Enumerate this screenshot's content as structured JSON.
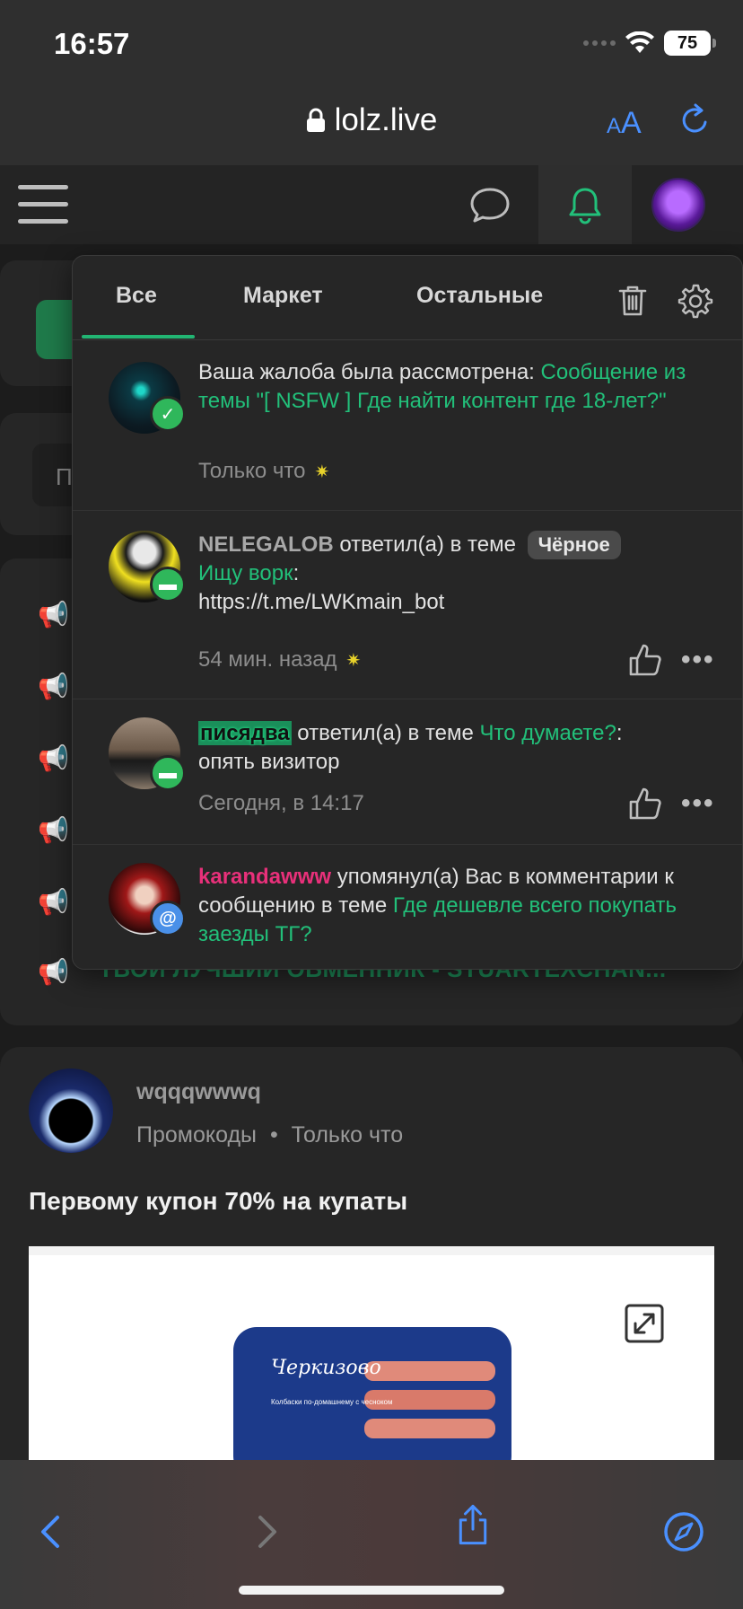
{
  "status": {
    "time": "16:57",
    "battery": "75"
  },
  "browser": {
    "url": "lolz.live",
    "text_size_small": "A",
    "text_size_large": "A"
  },
  "tabs": [
    "Все",
    "Маркет",
    "Остальные"
  ],
  "notifications": {
    "n1": {
      "prefix": "Ваша жалоба была рассмотрена: ",
      "link": "Сообщение из темы \"[ NSFW ] Где найти контент где 18-лет?\"",
      "time": "Только что"
    },
    "n2": {
      "user": "NELEGALOB",
      "action": " ответил(а) в теме ",
      "tag": "Чёрное",
      "topic": "Ищу ворк",
      "colon": ":",
      "message": "https://t.me/LWKmain_bot",
      "time": "54 мин. назад"
    },
    "n3": {
      "user": "писядва",
      "action": " ответил(а) в теме ",
      "topic": "Что думаете?",
      "colon": ":",
      "message": "опять визитор",
      "time": "Сегодня, в 14:17"
    },
    "n4": {
      "user": "karandawww",
      "action": " упомянул(а) Вас в комментарии к сообщению в теме ",
      "topic": "Где дешевле всего покупать заезды ТГ?"
    }
  },
  "background": {
    "input_letter": "П",
    "ticker": "ТВОЙ ЛУЧШИЙ ОБМЕННИК - STUARTEXCHAN..."
  },
  "post": {
    "author": "wqqqwwwq",
    "category": "Промокоды",
    "separator": "•",
    "time": "Только что",
    "title": "Первому купон 70% на купаты",
    "brand": "Черкизово",
    "product": "Колбаски по-домашнему с чесноком"
  },
  "colors": {
    "accent": "#22c07a",
    "mention": "#e8307a",
    "ios_blue": "#4a90ff"
  }
}
